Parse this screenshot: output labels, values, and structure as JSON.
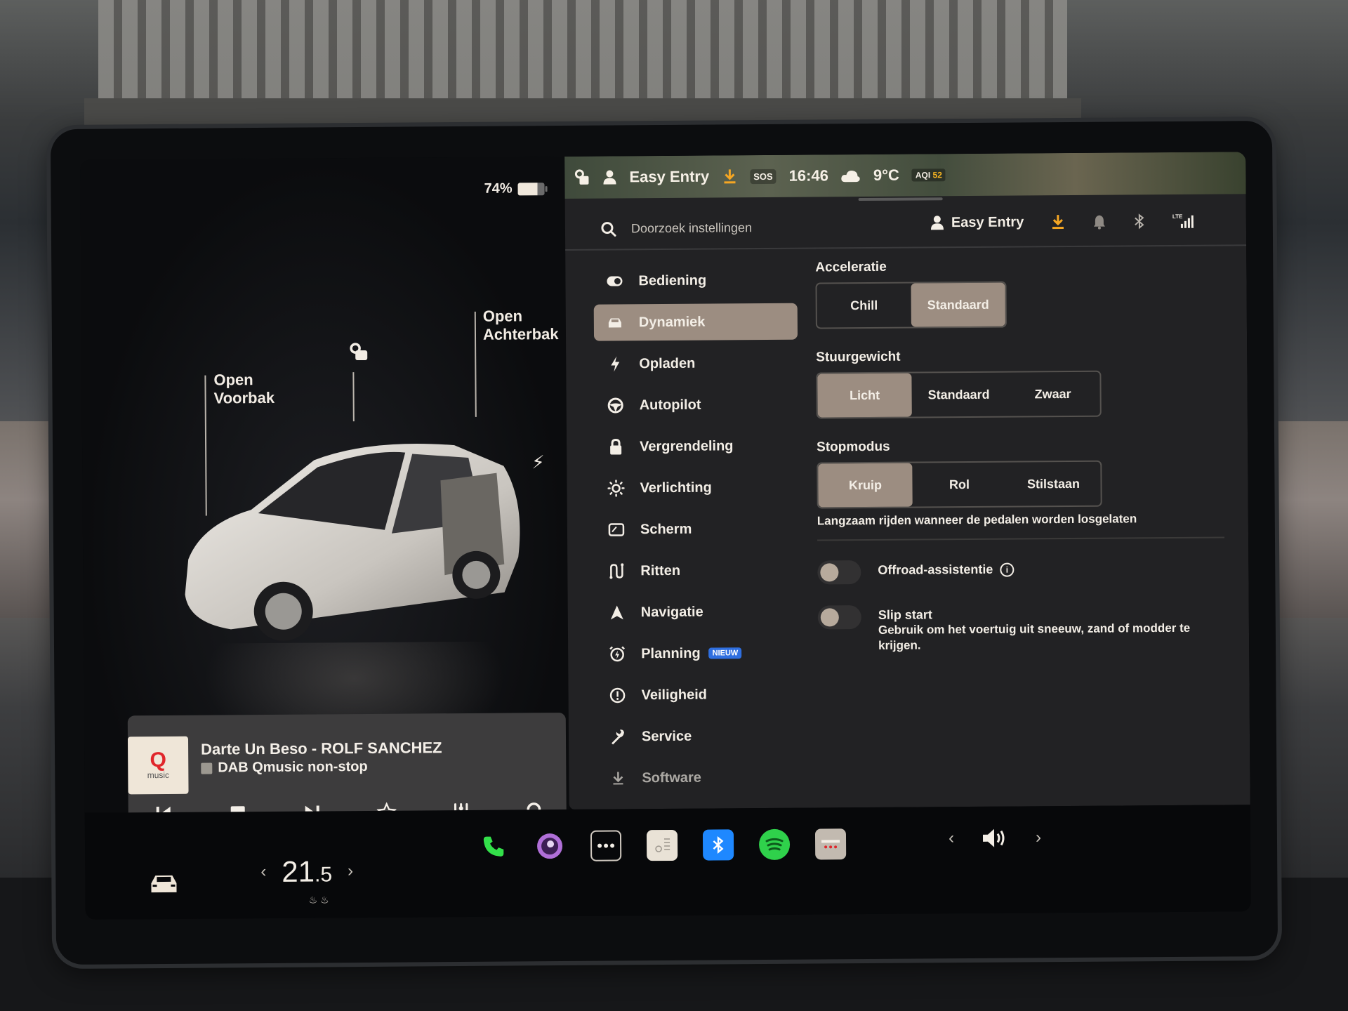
{
  "status_bar": {
    "battery_percent": "74%",
    "battery_level": 0.74,
    "profile": "Easy Entry",
    "sos": "SOS",
    "time": "16:46",
    "temperature": "9°C",
    "aqi_label": "AQI",
    "aqi_value": "52"
  },
  "car_view": {
    "frunk_label_line1": "Open",
    "frunk_label_line2": "Voorbak",
    "trunk_label_line1": "Open",
    "trunk_label_line2": "Achterbak",
    "lock_state": "unlocked"
  },
  "media": {
    "logo_text": "Q",
    "logo_sub": "music",
    "title": "Darte Un Beso - ROLF SANCHEZ",
    "station": "DAB Qmusic non-stop",
    "controls": [
      "previous",
      "stop",
      "next",
      "favorite",
      "equalizer",
      "search"
    ]
  },
  "settings": {
    "search_placeholder": "Doorzoek instellingen",
    "profile": "Easy Entry",
    "menu": [
      {
        "label": "Bediening",
        "icon": "toggle-icon"
      },
      {
        "label": "Dynamiek",
        "icon": "car-icon",
        "active": true
      },
      {
        "label": "Opladen",
        "icon": "bolt-icon"
      },
      {
        "label": "Autopilot",
        "icon": "steering-wheel-icon"
      },
      {
        "label": "Vergrendeling",
        "icon": "lock-icon"
      },
      {
        "label": "Verlichting",
        "icon": "sun-icon"
      },
      {
        "label": "Scherm",
        "icon": "display-icon"
      },
      {
        "label": "Ritten",
        "icon": "trips-icon"
      },
      {
        "label": "Navigatie",
        "icon": "navigation-arrow-icon"
      },
      {
        "label": "Planning",
        "icon": "alarm-clock-icon",
        "badge": "NIEUW"
      },
      {
        "label": "Veiligheid",
        "icon": "alert-circle-icon"
      },
      {
        "label": "Service",
        "icon": "wrench-icon"
      },
      {
        "label": "Software",
        "icon": "download-icon"
      }
    ],
    "acceleration": {
      "title": "Acceleratie",
      "options": [
        "Chill",
        "Standaard"
      ],
      "selected": "Standaard"
    },
    "steering": {
      "title": "Stuurgewicht",
      "options": [
        "Licht",
        "Standaard",
        "Zwaar"
      ],
      "selected": "Licht"
    },
    "stop_mode": {
      "title": "Stopmodus",
      "options": [
        "Kruip",
        "Rol",
        "Stilstaan"
      ],
      "selected": "Kruip",
      "description": "Langzaam rijden wanneer de pedalen worden losgelaten"
    },
    "offroad": {
      "label": "Offroad-assistentie",
      "enabled": false
    },
    "slip_start": {
      "label": "Slip start",
      "description": "Gebruik om het voertuig uit sneeuw, zand of modder te krijgen.",
      "enabled": false
    }
  },
  "dock": {
    "cabin_temp_whole": "21",
    "cabin_temp_decimal": ".5",
    "apps": [
      "phone",
      "camera",
      "more",
      "notepad",
      "bluetooth",
      "spotify",
      "calendar"
    ]
  },
  "colors": {
    "accent_selected": "#9c8d81",
    "download_orange": "#f5a623",
    "new_badge_blue": "#2f6fe0",
    "spotify_green": "#2fd14b",
    "phone_green": "#33e04a",
    "bluetooth_blue": "#1e88ff"
  }
}
